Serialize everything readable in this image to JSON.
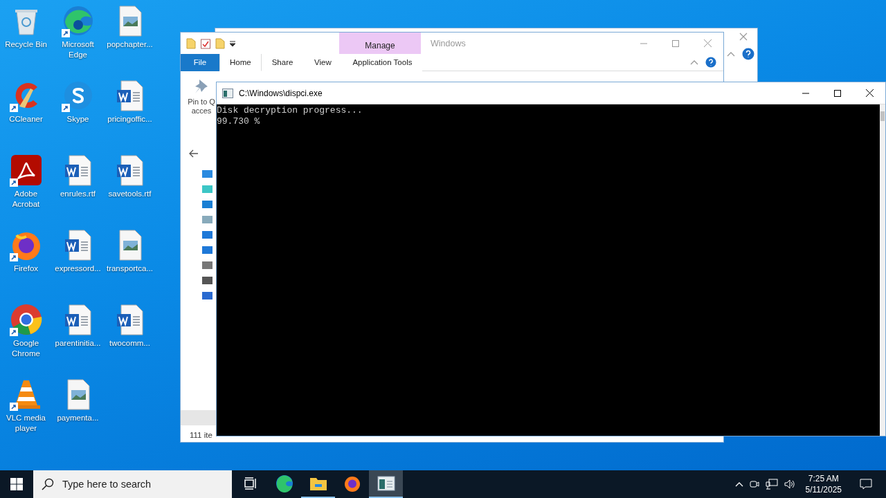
{
  "desktop_icons": [
    {
      "label": "Recycle Bin",
      "kind": "recycle",
      "shortcut": false
    },
    {
      "label": "CCleaner",
      "kind": "ccleaner",
      "shortcut": true
    },
    {
      "label": "Adobe Acrobat",
      "kind": "acrobat",
      "shortcut": true
    },
    {
      "label": "Firefox",
      "kind": "firefox",
      "shortcut": true
    },
    {
      "label": "Google Chrome",
      "kind": "chrome",
      "shortcut": true
    },
    {
      "label": "VLC media player",
      "kind": "vlc",
      "shortcut": true
    },
    {
      "label": "Microsoft Edge",
      "kind": "edge",
      "shortcut": true
    },
    {
      "label": "Skype",
      "kind": "skype",
      "shortcut": true
    },
    {
      "label": "enrules.rtf",
      "kind": "word",
      "shortcut": false
    },
    {
      "label": "expressord...",
      "kind": "word",
      "shortcut": false
    },
    {
      "label": "parentinitia...",
      "kind": "word",
      "shortcut": false
    },
    {
      "label": "paymenta...",
      "kind": "image",
      "shortcut": false
    },
    {
      "label": "popchapter...",
      "kind": "image",
      "shortcut": false
    },
    {
      "label": "pricingoffic...",
      "kind": "word",
      "shortcut": false
    },
    {
      "label": "savetools.rtf",
      "kind": "word",
      "shortcut": false
    },
    {
      "label": "transportca...",
      "kind": "image",
      "shortcut": false
    },
    {
      "label": "twocomm...",
      "kind": "word",
      "shortcut": false
    }
  ],
  "explorer": {
    "title": "Windows",
    "context_tab": "Manage",
    "ribbon_tabs": [
      {
        "label": "File",
        "kind": "file",
        "selected": false
      },
      {
        "label": "Home",
        "kind": "tab",
        "selected": true
      },
      {
        "label": "Share",
        "kind": "tab",
        "selected": false
      },
      {
        "label": "View",
        "kind": "tab",
        "selected": false
      },
      {
        "label": "Application Tools",
        "kind": "context",
        "selected": false
      }
    ],
    "ribbon_command": [
      "Pin to Q",
      "acces"
    ],
    "status": "111 ite"
  },
  "console": {
    "title": "C:\\Windows\\dispci.exe",
    "lines": [
      "Disk decryption progress...",
      "99.730 %"
    ]
  },
  "taskbar": {
    "search": {
      "placeholder": "Type here to search"
    },
    "apps": [
      {
        "kind": "taskview",
        "running": false,
        "selected": false
      },
      {
        "kind": "edge",
        "running": false,
        "selected": false
      },
      {
        "kind": "explorer",
        "running": true,
        "selected": false
      },
      {
        "kind": "firefox",
        "running": false,
        "selected": false
      },
      {
        "kind": "console",
        "running": true,
        "selected": true
      }
    ],
    "time": "7:25 AM",
    "date": "5/11/2025"
  }
}
